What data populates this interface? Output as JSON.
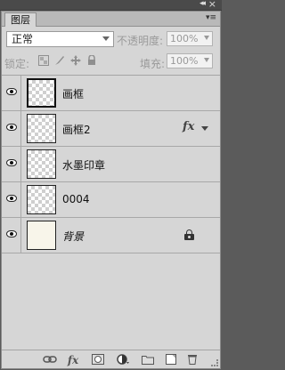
{
  "window": {
    "collapse_icon": "◂◂",
    "close_icon": "×"
  },
  "tabs": [
    {
      "label": "图层"
    }
  ],
  "panel_menu_icon": "▾≡",
  "blend_mode": {
    "value": "正常"
  },
  "opacity": {
    "label": "不透明度:",
    "value": "100%"
  },
  "lock": {
    "label": "锁定:",
    "icons": [
      "lock-transparent-pixels-icon",
      "lock-image-pixels-icon",
      "lock-position-icon",
      "lock-all-icon"
    ]
  },
  "fill": {
    "label": "填充:",
    "value": "100%"
  },
  "layers": [
    {
      "name": "画框",
      "visible": true,
      "selected": true,
      "has_fx": false,
      "locked": false
    },
    {
      "name": "画框2",
      "visible": true,
      "selected": false,
      "has_fx": true,
      "locked": false
    },
    {
      "name": "水墨印章",
      "visible": true,
      "selected": false,
      "has_fx": false,
      "locked": false
    },
    {
      "name": "0004",
      "visible": true,
      "selected": false,
      "has_fx": false,
      "locked": false
    },
    {
      "name": "背景",
      "visible": true,
      "selected": false,
      "has_fx": false,
      "locked": true
    }
  ],
  "fx_label": "fx",
  "bottom_icons": [
    "link-layers-icon",
    "layer-style-icon",
    "layer-mask-icon",
    "adjustment-layer-icon",
    "new-group-icon",
    "new-layer-icon",
    "delete-layer-icon"
  ]
}
